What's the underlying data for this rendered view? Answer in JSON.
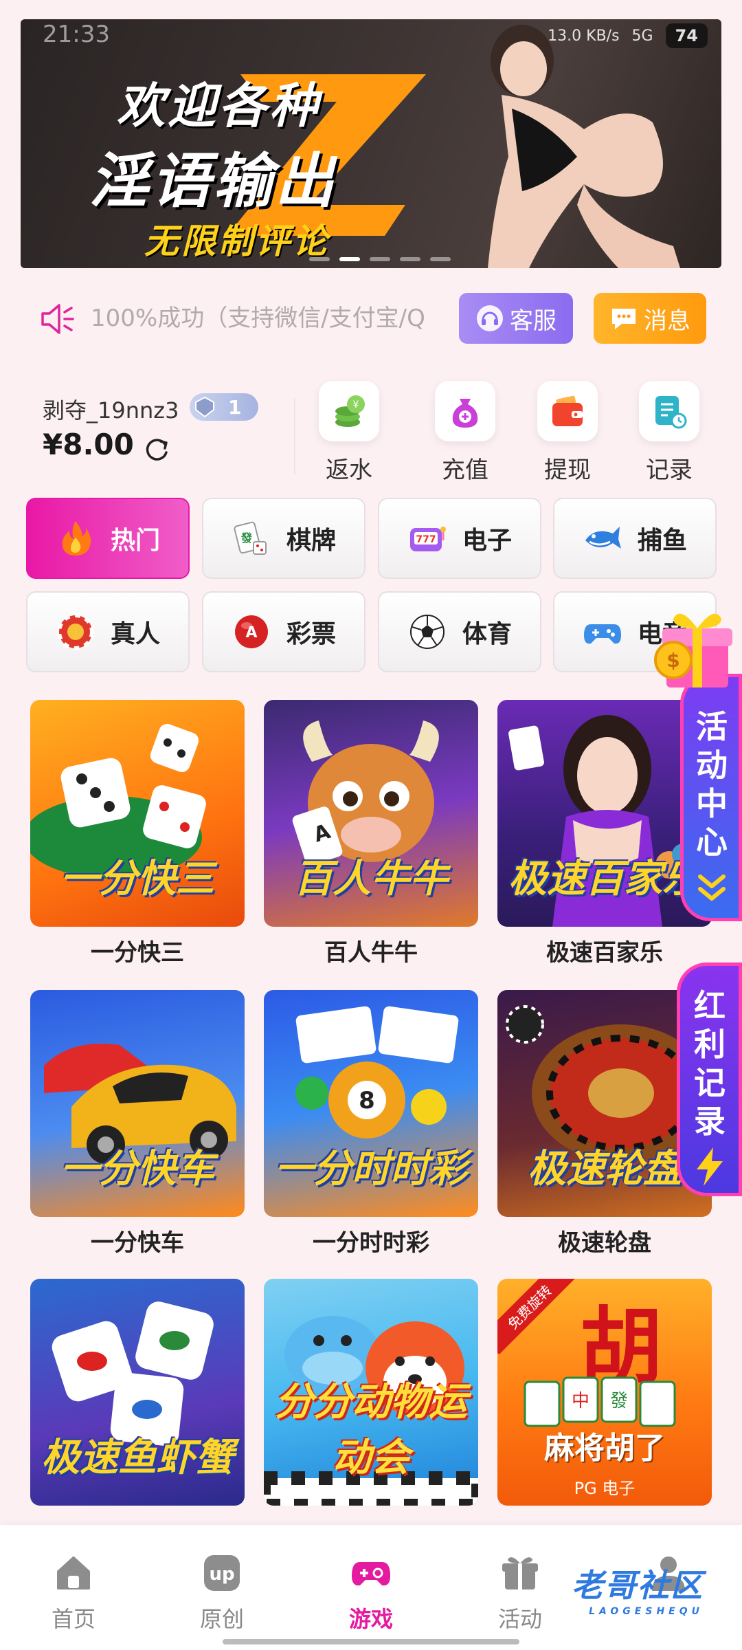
{
  "status": {
    "time": "21:33",
    "speed": "13.0 KB/s",
    "network": "5G",
    "battery": "74"
  },
  "banner": {
    "line1": "欢迎各种",
    "line2": "淫语输出",
    "line3": "无限制评论"
  },
  "notice": {
    "text": "100%成功（支持微信/支付宝/Q",
    "service_label": "客服",
    "message_label": "消息"
  },
  "user": {
    "name": "剥夺_19nnz3",
    "vip_level": "1",
    "balance": "¥8.00"
  },
  "quick_actions": [
    "返水",
    "充值",
    "提现",
    "记录"
  ],
  "categories": [
    {
      "label": "热门",
      "icon": "fire-icon",
      "active": true
    },
    {
      "label": "棋牌",
      "icon": "mahjong-icon"
    },
    {
      "label": "电子",
      "icon": "slot-machine-icon"
    },
    {
      "label": "捕鱼",
      "icon": "shark-icon"
    },
    {
      "label": "真人",
      "icon": "casino-chip-icon"
    },
    {
      "label": "彩票",
      "icon": "lottery-ball-icon"
    },
    {
      "label": "体育",
      "icon": "soccer-ball-icon"
    },
    {
      "label": "电竞",
      "icon": "gamepad-icon"
    }
  ],
  "games": [
    {
      "title": "一分快三",
      "art": "一分快三"
    },
    {
      "title": "百人牛牛",
      "art": "百人牛牛"
    },
    {
      "title": "极速百家乐",
      "art": "极速百家乐"
    },
    {
      "title": "一分快车",
      "art": "一分快车"
    },
    {
      "title": "一分时时彩",
      "art": "一分时时彩"
    },
    {
      "title": "极速轮盘",
      "art": "极速轮盘"
    },
    {
      "title": "极速鱼虾蟹",
      "art": "极速鱼虾蟹"
    },
    {
      "title": "分分动物运动会",
      "art": "分分动物运动会"
    },
    {
      "title": "麻将胡了",
      "art": "麻将胡了",
      "sub": "PG 电子",
      "tag": "免费旋转"
    }
  ],
  "floating": {
    "activity": "活动中心",
    "redpacket": "红利记录"
  },
  "nav": [
    {
      "label": "首页",
      "icon": "home-icon"
    },
    {
      "label": "原创",
      "icon": "up-icon"
    },
    {
      "label": "游戏",
      "icon": "gamepad-icon",
      "active": true
    },
    {
      "label": "活动",
      "icon": "gift-icon"
    },
    {
      "label": "我的",
      "icon": "user-icon"
    }
  ],
  "watermark": {
    "text": "老哥社区",
    "sub": "LAOGESHEQU"
  },
  "colors": {
    "accent": "#e41aa0",
    "service": "#8b6cf0",
    "message": "#ff9a0e"
  }
}
